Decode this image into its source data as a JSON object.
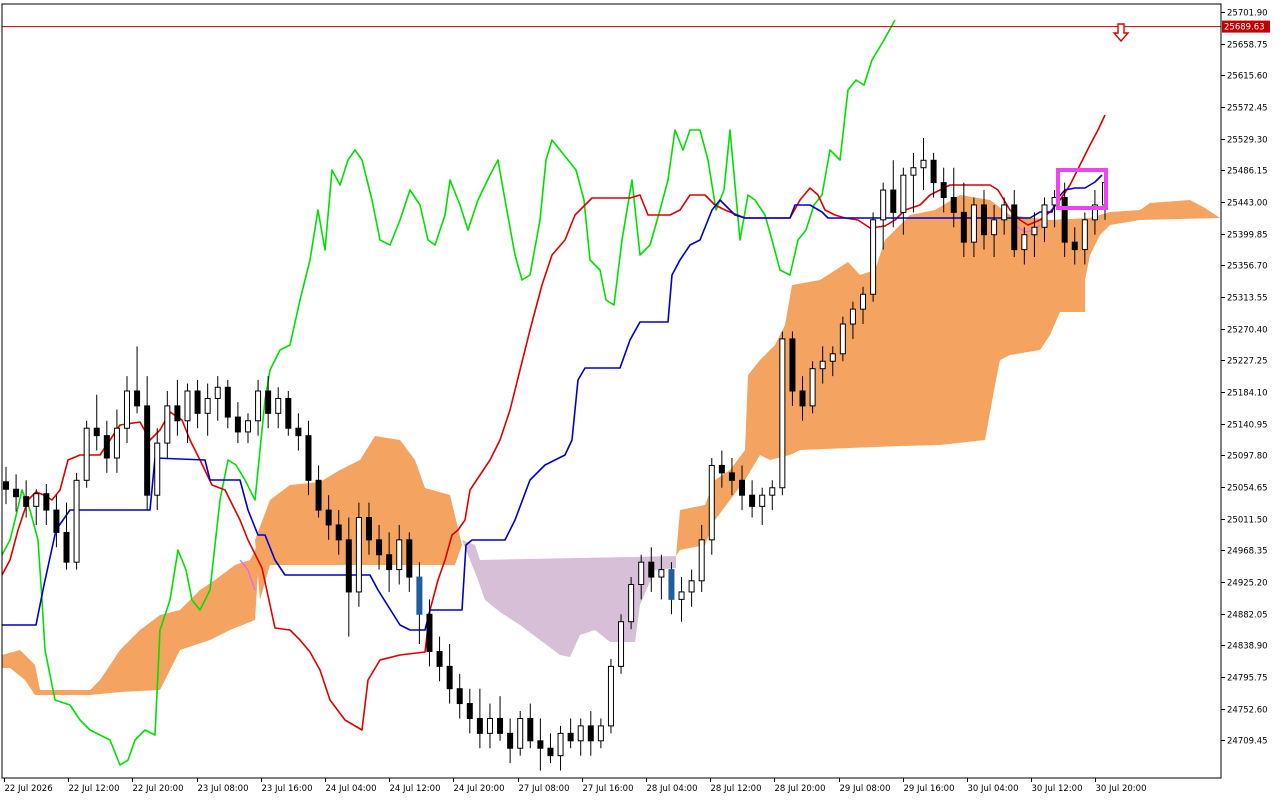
{
  "chart_data": {
    "type": "candlestick",
    "y_ticks": [
      "25701.90",
      "25658.75",
      "25615.60",
      "25572.45",
      "25529.30",
      "25486.15",
      "25443.00",
      "25399.85",
      "25356.70",
      "25313.55",
      "25270.40",
      "25227.25",
      "25184.10",
      "25140.95",
      "25097.80",
      "25054.65",
      "25011.50",
      "24968.35",
      "24925.20",
      "24882.05",
      "24838.90",
      "24795.75",
      "24752.60",
      "24709.45"
    ],
    "ylim": [
      24680,
      25720
    ],
    "x_ticks": [
      "22 Jul 2026",
      "22 Jul 12:00",
      "22 Jul 20:00",
      "23 Jul 08:00",
      "23 Jul 16:00",
      "24 Jul 04:00",
      "24 Jul 12:00",
      "24 Jul 20:00",
      "27 Jul 08:00",
      "27 Jul 16:00",
      "28 Jul 04:00",
      "28 Jul 12:00",
      "28 Jul 20:00",
      "29 Jul 08:00",
      "29 Jul 16:00",
      "30 Jul 04:00",
      "30 Jul 12:00",
      "30 Jul 20:00"
    ],
    "current_price": "25689.63",
    "current_price_value": 25689.63,
    "colors": {
      "tenkan": "#e00000",
      "kijun": "#0000cc",
      "chikou": "#00e000",
      "kumo_bull": "#f4a460",
      "kumo_bear": "#d8bfd8",
      "price_line": "#c00000",
      "highlight_box": "#ee44ee",
      "arrow": "#e00000",
      "bar_up": "#000000",
      "bar_down": "#000000",
      "bar_highlight": "#1f5fa0"
    },
    "candles": [
      [
        25078,
        25098,
        25048,
        25068
      ],
      [
        25068,
        25088,
        25038,
        25058
      ],
      [
        25058,
        25080,
        25030,
        25045
      ],
      [
        25045,
        25068,
        25020,
        25062
      ],
      [
        25062,
        25075,
        25020,
        25040
      ],
      [
        25040,
        25060,
        24990,
        25010
      ],
      [
        25010,
        25050,
        24960,
        24970
      ],
      [
        24970,
        25090,
        24960,
        25080
      ],
      [
        25080,
        25160,
        25070,
        25150
      ],
      [
        25150,
        25195,
        25120,
        25140
      ],
      [
        25140,
        25160,
        25090,
        25110
      ],
      [
        25110,
        25175,
        25090,
        25150
      ],
      [
        25150,
        25220,
        25130,
        25200
      ],
      [
        25200,
        25260,
        25170,
        25180
      ],
      [
        25180,
        25220,
        25040,
        25060
      ],
      [
        25060,
        25150,
        25040,
        25130
      ],
      [
        25130,
        25200,
        25110,
        25180
      ],
      [
        25180,
        25215,
        25140,
        25160
      ],
      [
        25160,
        25210,
        25130,
        25200
      ],
      [
        25200,
        25215,
        25150,
        25170
      ],
      [
        25170,
        25210,
        25140,
        25190
      ],
      [
        25190,
        25220,
        25160,
        25205
      ],
      [
        25205,
        25215,
        25150,
        25165
      ],
      [
        25165,
        25185,
        25130,
        25145
      ],
      [
        25145,
        25170,
        25130,
        25160
      ],
      [
        25160,
        25215,
        25140,
        25200
      ],
      [
        25200,
        25220,
        25150,
        25170
      ],
      [
        25170,
        25205,
        25150,
        25190
      ],
      [
        25190,
        25200,
        25140,
        25150
      ],
      [
        25150,
        25170,
        25120,
        25140
      ],
      [
        25140,
        25160,
        25060,
        25080
      ],
      [
        25080,
        25100,
        25030,
        25040
      ],
      [
        25040,
        25060,
        25000,
        25020
      ],
      [
        25020,
        25040,
        24980,
        25000
      ],
      [
        25000,
        25030,
        24870,
        24930
      ],
      [
        24930,
        25050,
        24910,
        25030
      ],
      [
        25030,
        25050,
        24980,
        25000
      ],
      [
        25000,
        25020,
        24960,
        24980
      ],
      [
        24980,
        25010,
        24930,
        24960
      ],
      [
        24960,
        25020,
        24940,
        25000
      ],
      [
        25000,
        25010,
        24930,
        24950
      ],
      [
        24950,
        24970,
        24860,
        24900
      ],
      [
        24900,
        24920,
        24830,
        24850
      ],
      [
        24850,
        24870,
        24810,
        24830
      ],
      [
        24830,
        24860,
        24780,
        24800
      ],
      [
        24800,
        24820,
        24760,
        24780
      ],
      [
        24780,
        24800,
        24740,
        24760
      ],
      [
        24760,
        24800,
        24720,
        24740
      ],
      [
        24740,
        24780,
        24720,
        24760
      ],
      [
        24760,
        24790,
        24730,
        24740
      ],
      [
        24740,
        24760,
        24700,
        24720
      ],
      [
        24720,
        24770,
        24710,
        24760
      ],
      [
        24760,
        24780,
        24720,
        24730
      ],
      [
        24730,
        24760,
        24690,
        24720
      ],
      [
        24720,
        24740,
        24700,
        24710
      ],
      [
        24710,
        24750,
        24690,
        24740
      ],
      [
        24740,
        24760,
        24720,
        24730
      ],
      [
        24730,
        24760,
        24710,
        24750
      ],
      [
        24750,
        24770,
        24710,
        24730
      ],
      [
        24730,
        24760,
        24720,
        24750
      ],
      [
        24750,
        24840,
        24740,
        24830
      ],
      [
        24830,
        24900,
        24820,
        24890
      ],
      [
        24890,
        24950,
        24880,
        24940
      ],
      [
        24940,
        24980,
        24920,
        24970
      ],
      [
        24970,
        24990,
        24930,
        24950
      ],
      [
        24950,
        24980,
        24920,
        24960
      ],
      [
        24960,
        24970,
        24900,
        24920
      ],
      [
        24920,
        24950,
        24890,
        24930
      ],
      [
        24930,
        24960,
        24910,
        24945
      ],
      [
        24945,
        25020,
        24930,
        25000
      ],
      [
        25000,
        25110,
        24980,
        25100
      ],
      [
        25100,
        25120,
        25070,
        25090
      ],
      [
        25090,
        25110,
        25060,
        25080
      ],
      [
        25080,
        25100,
        25040,
        25060
      ],
      [
        25060,
        25080,
        25030,
        25045
      ],
      [
        25045,
        25070,
        25020,
        25060
      ],
      [
        25060,
        25080,
        25040,
        25070
      ],
      [
        25070,
        25280,
        25060,
        25270
      ],
      [
        25270,
        25280,
        25180,
        25200
      ],
      [
        25200,
        25220,
        25160,
        25180
      ],
      [
        25180,
        25240,
        25170,
        25230
      ],
      [
        25230,
        25260,
        25210,
        25240
      ],
      [
        25240,
        25260,
        25220,
        25250
      ],
      [
        25250,
        25300,
        25240,
        25290
      ],
      [
        25290,
        25320,
        25270,
        25310
      ],
      [
        25310,
        25340,
        25290,
        25330
      ],
      [
        25330,
        25440,
        25320,
        25430
      ],
      [
        25430,
        25480,
        25390,
        25470
      ],
      [
        25470,
        25510,
        25420,
        25440
      ],
      [
        25440,
        25500,
        25410,
        25490
      ],
      [
        25490,
        25520,
        25440,
        25500
      ],
      [
        25500,
        25540,
        25470,
        25510
      ],
      [
        25510,
        25520,
        25460,
        25480
      ],
      [
        25480,
        25500,
        25440,
        25460
      ],
      [
        25460,
        25500,
        25420,
        25440
      ],
      [
        25440,
        25480,
        25380,
        25400
      ],
      [
        25400,
        25460,
        25380,
        25450
      ],
      [
        25450,
        25470,
        25390,
        25410
      ],
      [
        25410,
        25450,
        25380,
        25430
      ],
      [
        25430,
        25460,
        25410,
        25450
      ],
      [
        25450,
        25470,
        25380,
        25390
      ],
      [
        25390,
        25420,
        25370,
        25410
      ],
      [
        25410,
        25440,
        25380,
        25420
      ],
      [
        25420,
        25460,
        25400,
        25450
      ],
      [
        25450,
        25470,
        25420,
        25460
      ],
      [
        25460,
        25480,
        25380,
        25400
      ],
      [
        25400,
        25420,
        25370,
        25390
      ],
      [
        25390,
        25440,
        25370,
        25430
      ],
      [
        25430,
        25470,
        25410,
        25450
      ],
      [
        25450,
        25490,
        25430,
        25480
      ]
    ]
  },
  "ui": {
    "title": "",
    "symbol": ""
  }
}
